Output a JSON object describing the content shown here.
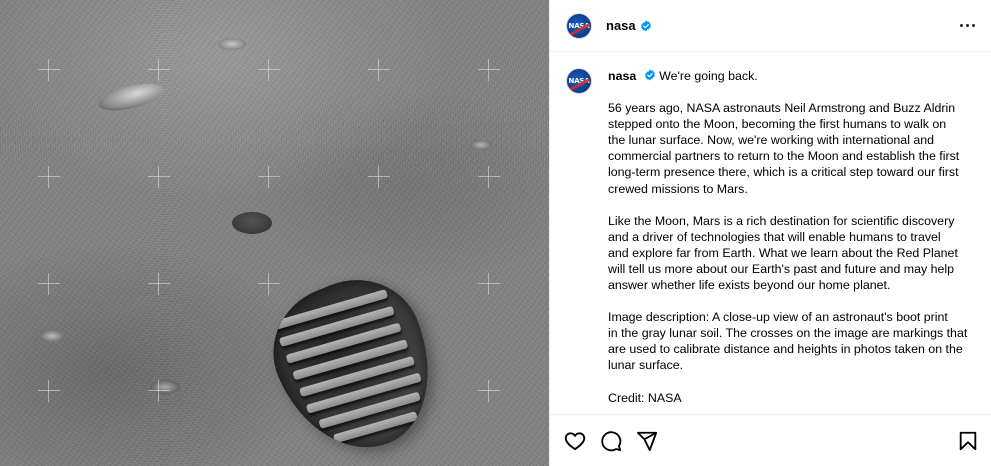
{
  "header": {
    "username": "nasa",
    "avatar_text": "NASA"
  },
  "caption": {
    "username": "nasa",
    "first_line": "We're going back.",
    "paragraphs": [
      "56 years ago, NASA astronauts Neil Armstrong and Buzz Aldrin\nstepped onto the Moon, becoming the first humans to walk on\nthe lunar surface. Now, we're working with international and\ncommercial partners to return to the Moon and establish the first\nlong-term presence there, which is a critical step toward our first\ncrewed missions to Mars.",
      "Like the Moon, Mars is a rich destination for scientific discovery\nand a driver of technologies that will enable humans to travel\nand explore far from Earth. What we learn about the Red Planet\nwill tell us more about our Earth's past and future and may help\nanswer whether life exists beyond our home planet.",
      "Image description: A close-up view of an astronaut's boot print\nin the gray lunar soil. The crosses on the image are markings that\nare used to calibrate distance and heights in photos taken on the\nlunar surface.",
      "Credit: NASA"
    ]
  },
  "icons": {
    "verified": "verified-badge-icon",
    "more": "more-options-icon",
    "like": "heart-icon",
    "comment": "comment-icon",
    "share": "share-icon",
    "save": "bookmark-icon"
  },
  "colors": {
    "verified": "#0095f6",
    "divider": "#efefef",
    "text": "#000000"
  }
}
